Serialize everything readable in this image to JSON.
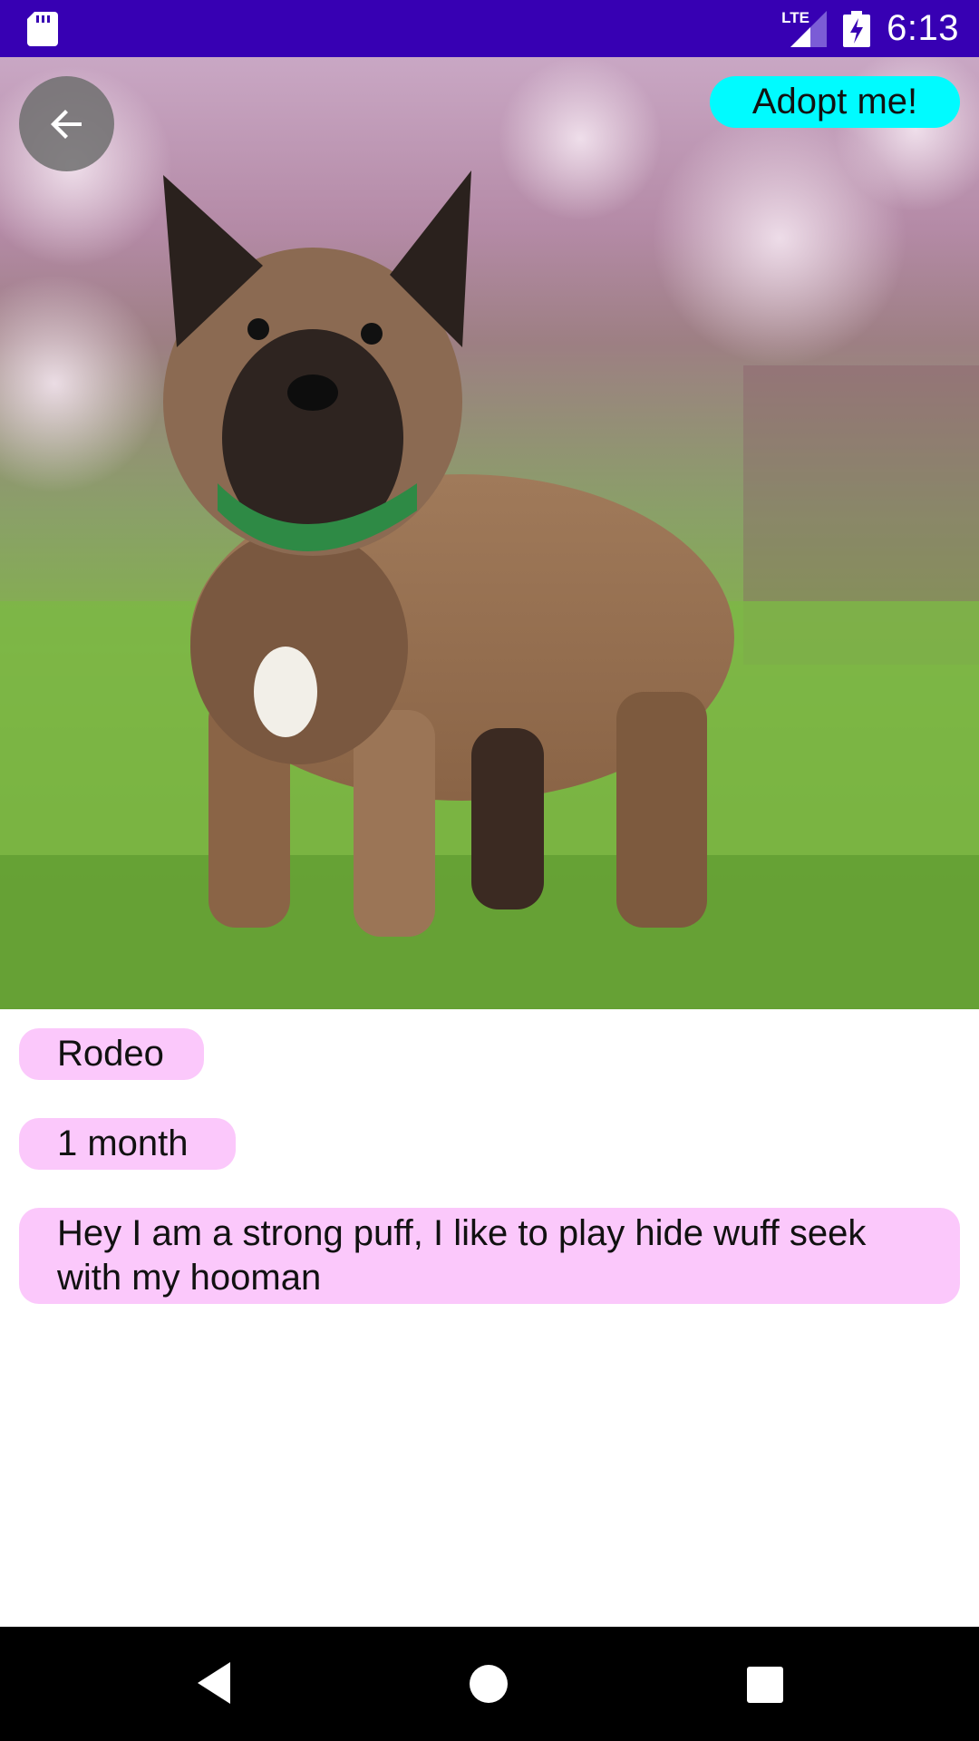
{
  "status_bar": {
    "network_label": "LTE",
    "time": "6:13",
    "icons": [
      "sd-card-icon",
      "lte-signal-icon",
      "battery-charging-icon"
    ]
  },
  "header": {
    "back_icon": "arrow-left-icon",
    "adopt_label": "Adopt me!"
  },
  "pet": {
    "name": "Rodeo",
    "age": "1 month",
    "description": "Hey I am a strong puff, I like to play hide wuff seek with my hooman",
    "photo_icon": "puppy-photo"
  },
  "colors": {
    "status_bar": "#3700b3",
    "adopt_button": "#00fbff",
    "chip": "#fbc8fb",
    "back_button": "#6e6e6e",
    "nav_bar": "#000000"
  },
  "nav_bar": {
    "icons": [
      "nav-back-icon",
      "nav-home-icon",
      "nav-recents-icon"
    ]
  }
}
